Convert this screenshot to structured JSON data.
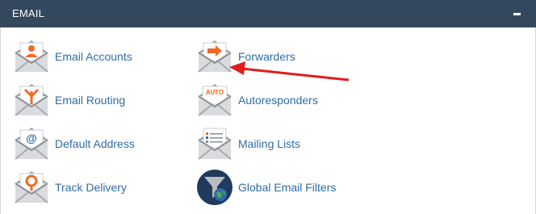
{
  "panel": {
    "title": "EMAIL",
    "collapse_icon": "minus-icon"
  },
  "colors": {
    "header_bg": "#34485d",
    "link": "#2f6ca5",
    "icon_orange": "#f06a26",
    "envelope_gray": "#8a8f95",
    "arrow_red": "#e11d1d"
  },
  "items": [
    {
      "label": "Email Accounts",
      "icon": "email-accounts-icon"
    },
    {
      "label": "Forwarders",
      "icon": "forwarders-icon"
    },
    {
      "label": "Email Routing",
      "icon": "email-routing-icon"
    },
    {
      "label": "Autoresponders",
      "icon": "autoresponders-icon",
      "badge": "AUTO"
    },
    {
      "label": "Default Address",
      "icon": "default-address-icon",
      "badge": "@"
    },
    {
      "label": "Mailing Lists",
      "icon": "mailing-lists-icon"
    },
    {
      "label": "Track Delivery",
      "icon": "track-delivery-icon"
    },
    {
      "label": "Global Email Filters",
      "icon": "global-email-filters-icon"
    }
  ]
}
